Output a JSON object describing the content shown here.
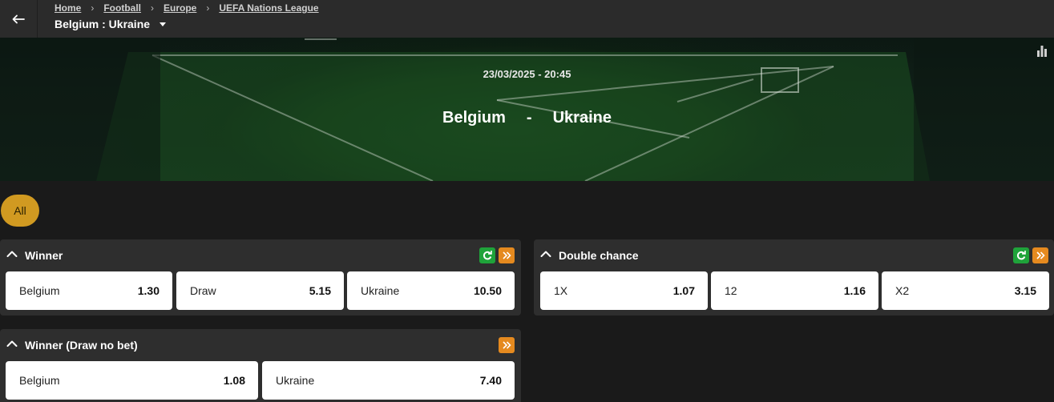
{
  "header": {
    "back_icon": "arrow-left-icon",
    "breadcrumb": [
      "Home",
      "Football",
      "Europe",
      "UEFA Nations League"
    ],
    "event_title": "Belgium : Ukraine"
  },
  "banner": {
    "date_time": "23/03/2025 - 20:45",
    "home_team": "Belgium",
    "separator": "-",
    "away_team": "Ukraine",
    "stats_icon": "bar-chart-icon"
  },
  "filters": {
    "selected": "All",
    "accent_color": "#d19a21"
  },
  "markets": [
    {
      "title": "Winner",
      "has_live_icon": true,
      "outcomes": [
        {
          "label": "Belgium",
          "odds": "1.30"
        },
        {
          "label": "Draw",
          "odds": "5.15"
        },
        {
          "label": "Ukraine",
          "odds": "10.50"
        }
      ]
    },
    {
      "title": "Double chance",
      "has_live_icon": true,
      "outcomes": [
        {
          "label": "1X",
          "odds": "1.07"
        },
        {
          "label": "12",
          "odds": "1.16"
        },
        {
          "label": "X2",
          "odds": "3.15"
        }
      ]
    },
    {
      "title": "Winner (Draw no bet)",
      "has_live_icon": false,
      "outcomes": [
        {
          "label": "Belgium",
          "odds": "1.08"
        },
        {
          "label": "Ukraine",
          "odds": "7.40"
        }
      ]
    }
  ],
  "colors": {
    "background": "#1a1a1a",
    "panel": "#2e2e2e",
    "live_green": "#1fa33a",
    "more_orange": "#e58a1f"
  }
}
